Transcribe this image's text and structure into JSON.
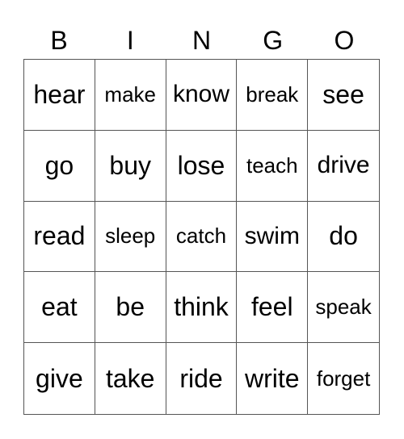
{
  "header": {
    "letters": [
      "B",
      "I",
      "N",
      "G",
      "O"
    ]
  },
  "card": {
    "rows": [
      [
        {
          "word": "hear",
          "size": "lg"
        },
        {
          "word": "make",
          "size": "sm"
        },
        {
          "word": "know",
          "size": "md"
        },
        {
          "word": "break",
          "size": "sm"
        },
        {
          "word": "see",
          "size": "lg"
        }
      ],
      [
        {
          "word": "go",
          "size": "lg"
        },
        {
          "word": "buy",
          "size": "lg"
        },
        {
          "word": "lose",
          "size": "lg"
        },
        {
          "word": "teach",
          "size": "sm"
        },
        {
          "word": "drive",
          "size": "md"
        }
      ],
      [
        {
          "word": "read",
          "size": "lg"
        },
        {
          "word": "sleep",
          "size": "sm"
        },
        {
          "word": "catch",
          "size": "sm"
        },
        {
          "word": "swim",
          "size": "md"
        },
        {
          "word": "do",
          "size": "lg"
        }
      ],
      [
        {
          "word": "eat",
          "size": "lg"
        },
        {
          "word": "be",
          "size": "lg"
        },
        {
          "word": "think",
          "size": "lg"
        },
        {
          "word": "feel",
          "size": "lg"
        },
        {
          "word": "speak",
          "size": "sm"
        }
      ],
      [
        {
          "word": "give",
          "size": "lg"
        },
        {
          "word": "take",
          "size": "lg"
        },
        {
          "word": "ride",
          "size": "lg"
        },
        {
          "word": "write",
          "size": "lg"
        },
        {
          "word": "forget",
          "size": "sm"
        }
      ]
    ]
  }
}
